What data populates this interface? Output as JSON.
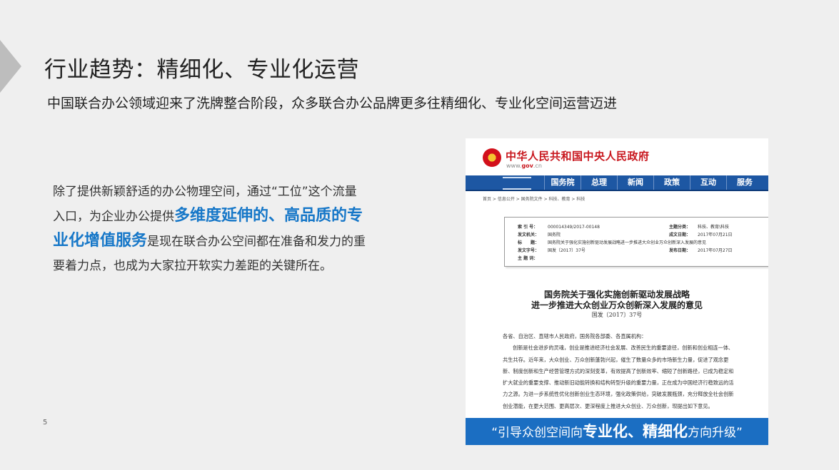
{
  "header": {
    "title": "行业趋势：精细化、专业化运营",
    "subtitle": "中国联合办公领域迎来了洗牌整合阶段，众多联合办公品牌更多往精细化、专业化空间运营迈进"
  },
  "body": {
    "p1": "除了提供新颖舒适的办公物理空间，通过“工位”这个流量入口，为企业办公提供",
    "highlight": "多维度延伸的、高品质的专业化增值服务",
    "p2": "是现在联合办公空间都在准备和发力的重要着力点，也成为大家拉开软实力差距的关键所在。"
  },
  "page_number": "5",
  "document": {
    "site_name": "中华人民共和国中央人民政府",
    "site_url_prefix": "www.",
    "site_url_domain": "gov",
    "site_url_suffix": ".cn",
    "nav": [
      "国务院",
      "总理",
      "新闻",
      "政策",
      "互动",
      "服务"
    ],
    "breadcrumb": "首页 > 信息公开 > 国务院文件 > 科技、教育 > 科技",
    "meta": {
      "index_label": "索 引 号：",
      "index_value": "000014349/2017-00148",
      "issuer_label": "发文机关：",
      "issuer_value": "国务院",
      "heading_label": "标　　题：",
      "heading_value": "国务院关于强化实施创新驱动发展战略进一步推进大众创业万众创新深入发展的意见",
      "docno_label": "发文字号：",
      "docno_value": "国发〔2017〕37号",
      "subject_label": "主 题 词：",
      "subject_value": "",
      "category_label": "主题分类：",
      "category_value": "科技、教育\\科技",
      "created_label": "成文日期：",
      "created_value": "2017年07月21日",
      "published_label": "发布日期：",
      "published_value": "2017年07月27日"
    },
    "title_line1": "国务院关于强化实施创新驱动发展战略",
    "title_line2": "进一步推进大众创业万众创新深入发展的意见",
    "doc_number": "国发〔2017〕37号",
    "salutation": "各省、自治区、直辖市人民政府，国务院各部委、各直属机构：",
    "body_text": "创新是社会进步的灵魂，创业是推进经济社会发展、改善民生的重要途径，创新和创业相连一体、共生共存。近年来，大众创业、万众创新蓬勃兴起，催生了数量众多的市场新生力量，促进了观念更新、制度创新和生产经营管理方式的深刻变革，有效提高了创新效率、缩短了创新路径，已成为稳定和扩大就业的重要支撑、推动新旧动能转换和结构转型升级的重要力量，正在成为中国经济行稳致远的活力之源。为进一步系统性优化创新创业生态环境，强化政策供给，突破发展瓶颈，充分释放全社会创新创业潜能，在更大范围、更高层次、更深程度上推进大众创业、万众创新，现提出如下意见。",
    "quote_prefix": "“引导众创空间向",
    "quote_emphasis": "专业化、精细化",
    "quote_suffix": "方向升级”"
  }
}
